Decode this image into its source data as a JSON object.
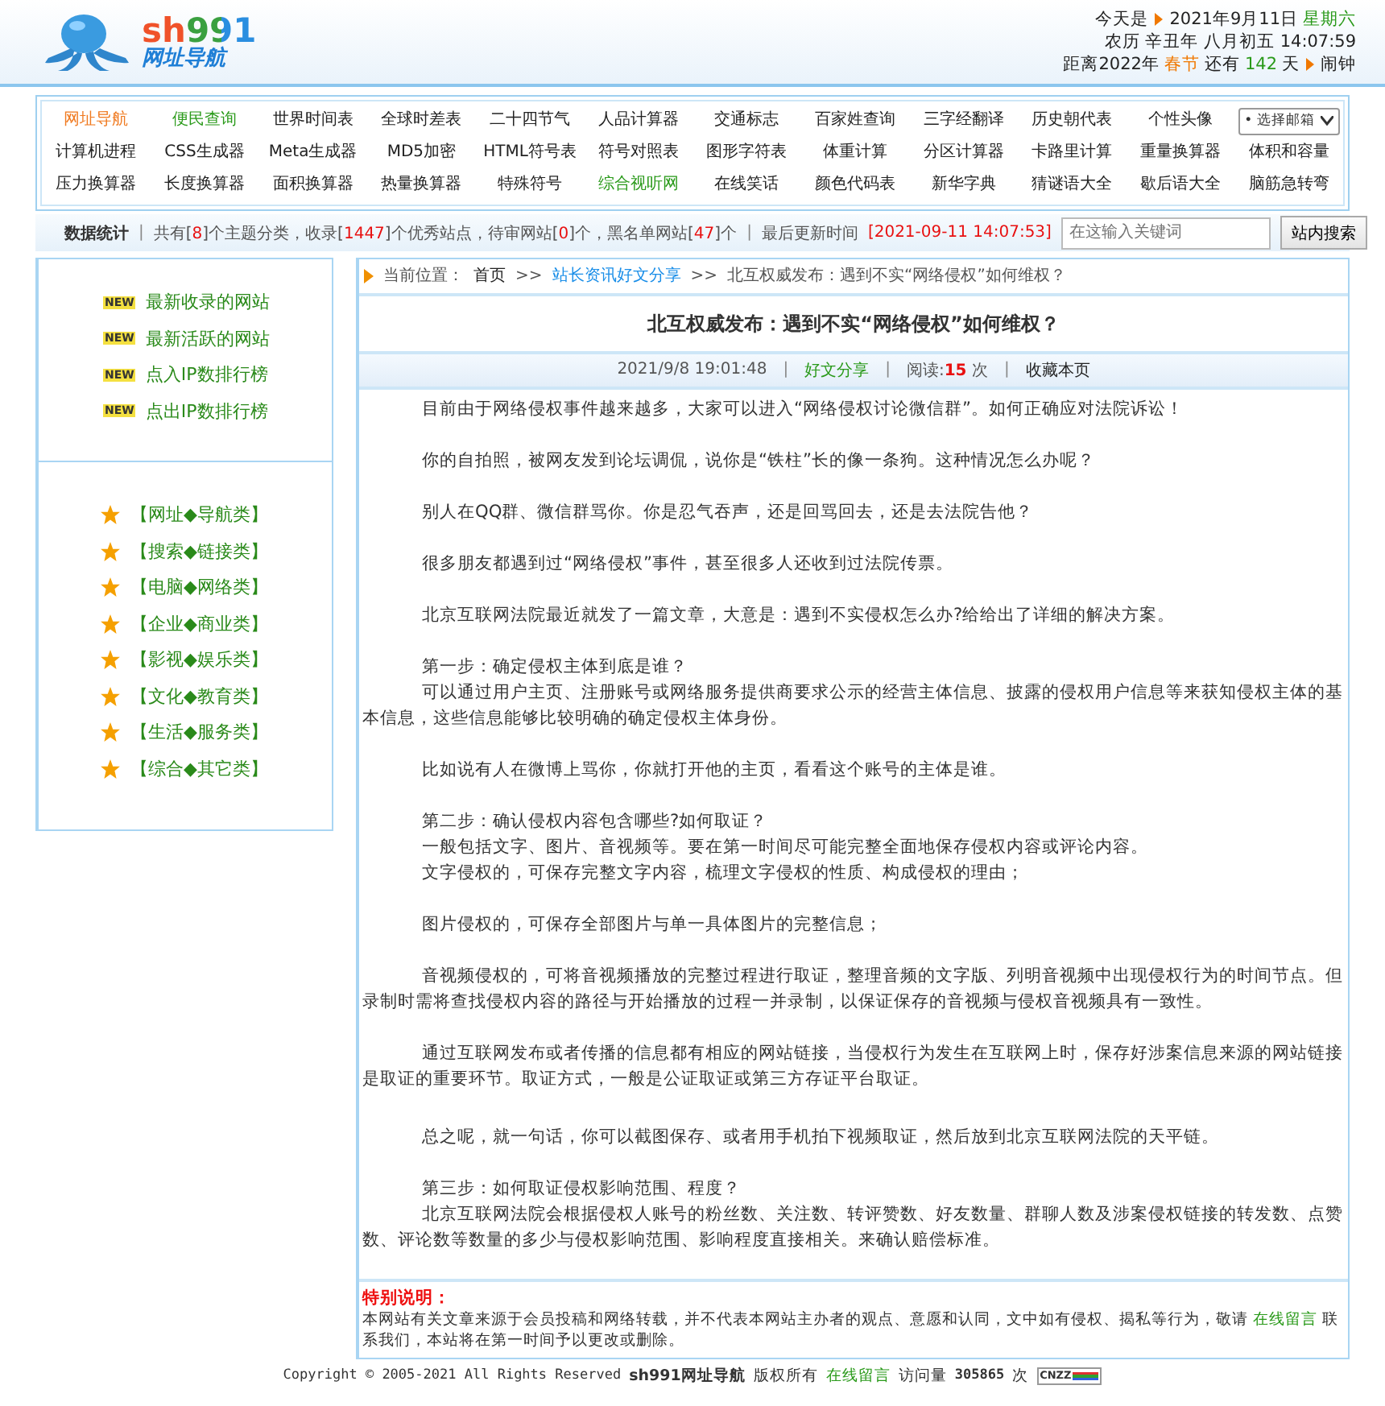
{
  "header": {
    "logo": {
      "brand": "sh991",
      "tagline": "网址导航"
    },
    "info_lines": [
      [
        {
          "text": "今天是",
          "kind": "plain"
        },
        {
          "kind": "arrow"
        },
        {
          "text": "2021年9月11日",
          "kind": "plain"
        },
        {
          "text": "星期六",
          "kind": "green"
        }
      ],
      [
        {
          "text": "农历 辛丑年 八月初五 14:07:59",
          "kind": "plain"
        }
      ],
      [
        {
          "text": "距离2022年",
          "kind": "plain"
        },
        {
          "text": "春节",
          "kind": "orange"
        },
        {
          "text": "还有",
          "kind": "plain"
        },
        {
          "text": "142",
          "kind": "green"
        },
        {
          "text": "天",
          "kind": "plain"
        },
        {
          "kind": "arrow"
        },
        {
          "text": "闹钟",
          "kind": "plain"
        }
      ]
    ]
  },
  "nav": {
    "links": [
      {
        "label": "网址导航",
        "kind": "active"
      },
      {
        "label": "便民查询",
        "kind": "hot"
      },
      {
        "label": "世界时间表",
        "kind": "normal"
      },
      {
        "label": "全球时差表",
        "kind": "normal"
      },
      {
        "label": "二十四节气",
        "kind": "normal"
      },
      {
        "label": "人品计算器",
        "kind": "normal"
      },
      {
        "label": "交通标志",
        "kind": "normal"
      },
      {
        "label": "百家姓查询",
        "kind": "normal"
      },
      {
        "label": "三字经翻译",
        "kind": "normal"
      },
      {
        "label": "历史朝代表",
        "kind": "normal"
      },
      {
        "label": "个性头像",
        "kind": "normal"
      },
      {
        "label": "计算机进程",
        "kind": "normal"
      },
      {
        "label": "CSS生成器",
        "kind": "normal"
      },
      {
        "label": "Meta生成器",
        "kind": "normal"
      },
      {
        "label": "MD5加密",
        "kind": "normal"
      },
      {
        "label": "HTML符号表",
        "kind": "normal"
      },
      {
        "label": "符号对照表",
        "kind": "normal"
      },
      {
        "label": "图形字符表",
        "kind": "normal"
      },
      {
        "label": "体重计算",
        "kind": "normal"
      },
      {
        "label": "分区计算器",
        "kind": "normal"
      },
      {
        "label": "卡路里计算",
        "kind": "normal"
      },
      {
        "label": "重量换算器",
        "kind": "normal"
      },
      {
        "label": "体积和容量",
        "kind": "normal"
      },
      {
        "label": "压力换算器",
        "kind": "normal"
      },
      {
        "label": "长度换算器",
        "kind": "normal"
      },
      {
        "label": "面积换算器",
        "kind": "normal"
      },
      {
        "label": "热量换算器",
        "kind": "normal"
      },
      {
        "label": "特殊符号",
        "kind": "normal"
      },
      {
        "label": "综合视听网",
        "kind": "hot"
      },
      {
        "label": "在线笑话",
        "kind": "normal"
      },
      {
        "label": "颜色代码表",
        "kind": "normal"
      },
      {
        "label": "新华字典",
        "kind": "normal"
      },
      {
        "label": "猜谜语大全",
        "kind": "normal"
      },
      {
        "label": "歇后语大全",
        "kind": "normal"
      },
      {
        "label": "脑筋急转弯",
        "kind": "normal"
      }
    ],
    "mail_select": "• 选择邮箱"
  },
  "stats": {
    "title": "数据统计",
    "separator": "|",
    "segments": [
      {
        "text": "共有[",
        "kind": "plain"
      },
      {
        "text": "8",
        "kind": "num"
      },
      {
        "text": "]个主题分类，收录[",
        "kind": "plain"
      },
      {
        "text": "1447",
        "kind": "num"
      },
      {
        "text": "]个优秀站点，待审网站[",
        "kind": "plain"
      },
      {
        "text": "0",
        "kind": "num"
      },
      {
        "text": "]个，黑名单网站[",
        "kind": "plain"
      },
      {
        "text": "47",
        "kind": "num"
      },
      {
        "text": "]个",
        "kind": "plain"
      }
    ],
    "updated_label": "最后更新时间",
    "updated": "[2021-09-11 14:07:53]",
    "search_placeholder": "在这输入关键词",
    "search_button": "站内搜索"
  },
  "sidebar": {
    "new_links": [
      {
        "badge": "NEW",
        "label": "最新收录的网站"
      },
      {
        "badge": "NEW",
        "label": "最新活跃的网站"
      },
      {
        "badge": "NEW",
        "label": "点入IP数排行榜"
      },
      {
        "badge": "NEW",
        "label": "点出IP数排行榜"
      }
    ],
    "categories": [
      "【网址◆导航类】",
      "【搜索◆链接类】",
      "【电脑◆网络类】",
      "【企业◆商业类】",
      "【影视◆娱乐类】",
      "【文化◆教育类】",
      "【生活◆服务类】",
      "【综合◆其它类】"
    ]
  },
  "article": {
    "breadcrumb": {
      "label": "当前位置：",
      "home": "首页",
      "sep1": ">>",
      "section": "站长资讯好文分享",
      "sep2": ">>",
      "current": "北互权威发布：遇到不实“网络侵权”如何维权？"
    },
    "title": "北互权威发布：遇到不实“网络侵权”如何维权？",
    "meta": {
      "separator": "|",
      "date": "2021/9/8 19:01:48",
      "category": "好文分享",
      "reads_label": "阅读:",
      "reads": "15",
      "reads_unit": "次",
      "bookmark": "收藏本页"
    },
    "blocks": [
      [
        "目前由于网络侵权事件越来越多，大家可以进入“网络侵权讨论微信群”。如何正确应对法院诉讼！"
      ],
      [
        "你的自拍照，被网友发到论坛调侃，说你是“铁柱”长的像一条狗。这种情况怎么办呢？"
      ],
      [
        "别人在QQ群、微信群骂你。你是忍气吞声，还是回骂回去，还是去法院告他？"
      ],
      [
        "很多朋友都遇到过“网络侵权”事件，甚至很多人还收到过法院传票。"
      ],
      [
        "北京互联网法院最近就发了一篇文章，大意是：遇到不实侵权怎么办?给给出了详细的解决方案。"
      ],
      [
        "第一步：确定侵权主体到底是谁？",
        "可以通过用户主页、注册账号或网络服务提供商要求公示的经营主体信息、披露的侵权用户信息等来获知侵权主体的基本信息，这些信息能够比较明确的确定侵权主体身份。"
      ],
      [
        "比如说有人在微博上骂你，你就打开他的主页，看看这个账号的主体是谁。"
      ],
      [
        "第二步：确认侵权内容包含哪些?如何取证？",
        "一般包括文字、图片、音视频等。要在第一时间尽可能完整全面地保存侵权内容或评论内容。",
        "文字侵权的，可保存完整文字内容，梳理文字侵权的性质、构成侵权的理由；"
      ],
      [
        "图片侵权的，可保存全部图片与单一具体图片的完整信息；"
      ],
      [
        "音视频侵权的，可将音视频播放的完整过程进行取证，整理音频的文字版、列明音视频中出现侵权行为的时间节点。但录制时需将查找侵权内容的路径与开始播放的过程一并录制，以保证保存的音视频与侵权音视频具有一致性。"
      ],
      [
        "通过互联网发布或者传播的信息都有相应的网站链接，当侵权行为发生在互联网上时，保存好涉案信息来源的网站链接是取证的重要环节。取证方式，一般是公证取证或第三方存证平台取证。"
      ],
      [
        "总之呢，就一句话，你可以截图保存、或者用手机拍下视频取证，然后放到北京互联网法院的天平链。"
      ],
      [
        "第三步：如何取证侵权影响范围、程度？",
        "北京互联网法院会根据侵权人账号的粉丝数、关注数、转评赞数、好友数量、群聊人数及涉案侵权链接的转发数、点赞数、评论数等数量的多少与侵权影响范围、影响程度直接相关。来确认赔偿标准。"
      ]
    ],
    "notice": {
      "title": "特别说明：",
      "before": "本网站有关文章来源于会员投稿和网络转载，并不代表本网站主办者的观点、意愿和认同，文中如有侵权、揭私等行为，敬请",
      "link": "在线留言",
      "after": "联系我们，本站将在第一时间予以更改或删除。"
    }
  },
  "footer": {
    "copyright": "Copyright © 2005-2021 All Rights Reserved",
    "site": "sh991网址导航",
    "rights": "版权所有",
    "link": "在线留言",
    "visits_label": "访问量",
    "visits": "305865",
    "visits_unit": "次",
    "counter_badge": "CNZZ"
  }
}
